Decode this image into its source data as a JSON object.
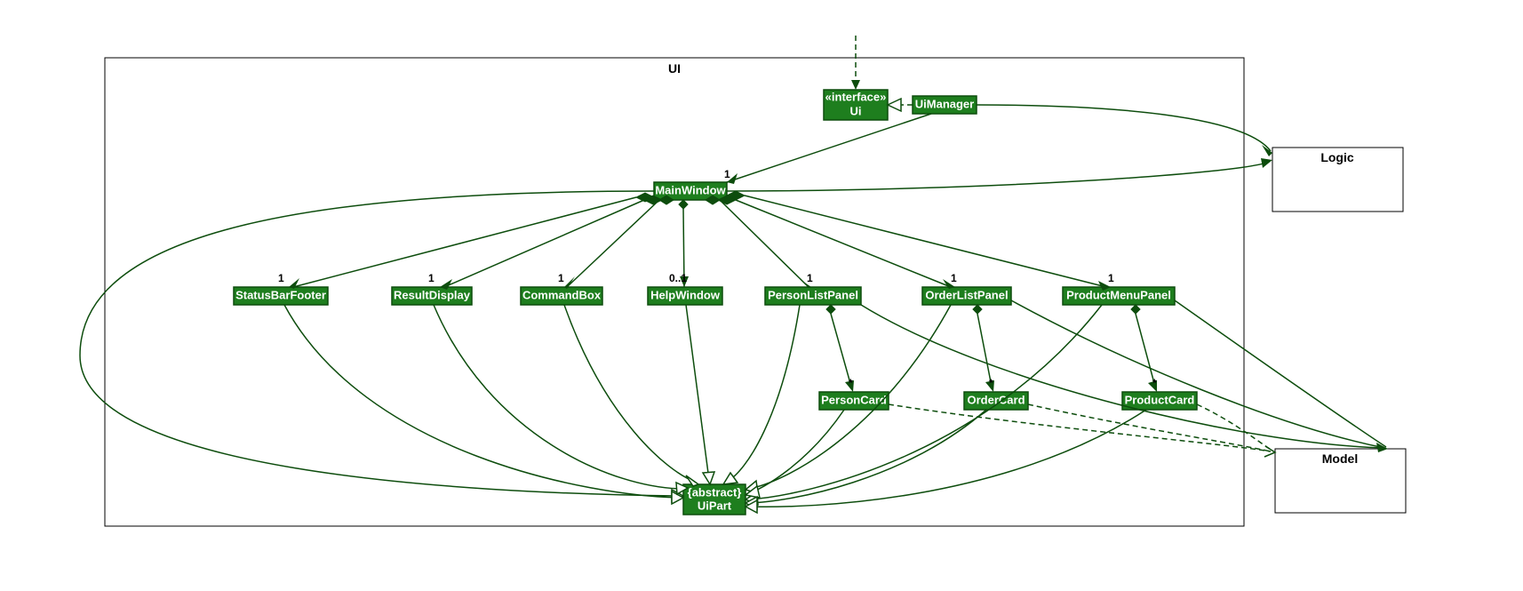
{
  "package": {
    "ui": "UI"
  },
  "classes": {
    "ui_stereo": "«interface»",
    "ui_name": "Ui",
    "uimanager": "UiManager",
    "mainwindow": "MainWindow",
    "statusbarfooter": "StatusBarFooter",
    "resultdisplay": "ResultDisplay",
    "commandbox": "CommandBox",
    "helpwindow": "HelpWindow",
    "personlistpanel": "PersonListPanel",
    "orderlistpanel": "OrderListPanel",
    "productmenupanel": "ProductMenuPanel",
    "personcard": "PersonCard",
    "ordercard": "OrderCard",
    "productcard": "ProductCard",
    "uipart_stereo": "{abstract}",
    "uipart_name": "UiPart",
    "logic": "Logic",
    "model": "Model"
  },
  "mult": {
    "mainwindow": "1",
    "statusbarfooter": "1",
    "resultdisplay": "1",
    "commandbox": "1",
    "helpwindow": "0..1",
    "personlistpanel": "1",
    "orderlistpanel": "1",
    "productmenupanel": "1",
    "personcard": "*",
    "ordercard": "*",
    "productcard": "*"
  }
}
